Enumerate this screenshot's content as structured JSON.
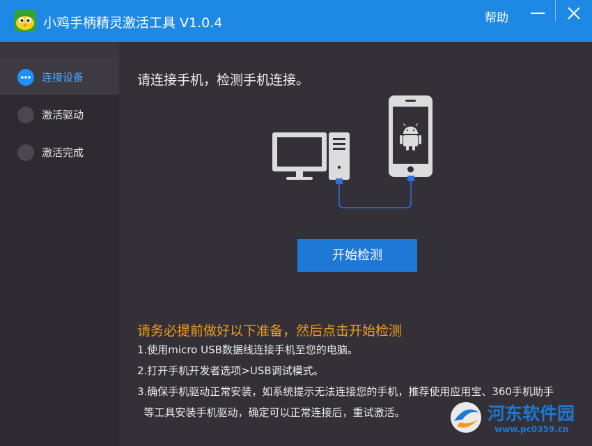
{
  "window": {
    "title": "小鸡手柄精灵激活工具 V1.0.4",
    "help_label": "帮助"
  },
  "sidebar": {
    "steps": [
      {
        "label": "连接设备",
        "active": true
      },
      {
        "label": "激活驱动",
        "active": false
      },
      {
        "label": "激活完成",
        "active": false
      }
    ]
  },
  "main": {
    "headline": "请连接手机，检测手机连接。",
    "start_button_label": "开始检测",
    "notice_title": "请务必提前做好以下准备，然后点击开始检测",
    "notice_lines": [
      "1.使用micro USB数据线连接手机至您的电脑。",
      "2.打开手机开发者选项>USB调试模式。",
      "3.确保手机驱动正常安装，如系统提示无法连接您的手机，推荐使用应用宝、360手机助手",
      "  等工具安装手机驱动，确定可以正常连接后，重试激活。"
    ]
  },
  "watermark": {
    "text": "河东软件园",
    "url": "www.pc0359.cn"
  },
  "colors": {
    "titlebar": "#1e88e5",
    "sidebar": "#2d2b31",
    "main": "#333137",
    "accent": "#1e78d6",
    "notice": "#f39a1e"
  },
  "icons": [
    "app-logo-icon",
    "minimize-icon",
    "close-icon",
    "computer-icon",
    "phone-android-icon",
    "usb-cable-icon"
  ]
}
